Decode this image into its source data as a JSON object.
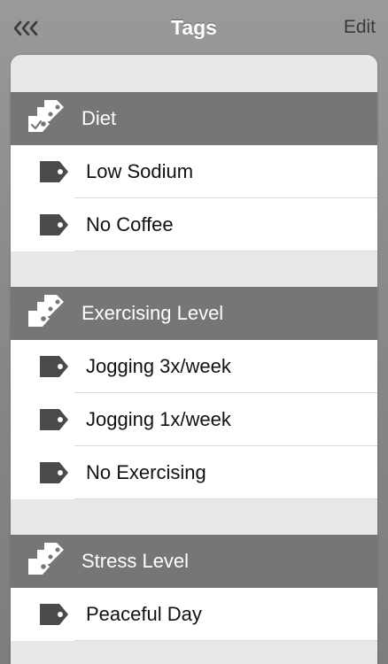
{
  "nav": {
    "back_icon": "triple-chevron-left-icon",
    "title": "Tags",
    "edit_label": "Edit"
  },
  "colors": {
    "section_header_bg": "#767676",
    "row_bg": "#ffffff",
    "icon_fill": "#4a4a4a"
  },
  "sections": [
    {
      "title": "Diet",
      "icon": "tags-stack-icon",
      "items": [
        {
          "label": "Low Sodium",
          "icon": "tag-icon"
        },
        {
          "label": "No Coffee",
          "icon": "tag-icon"
        }
      ]
    },
    {
      "title": "Exercising Level",
      "icon": "tags-stack-icon",
      "items": [
        {
          "label": "Jogging 3x/week",
          "icon": "tag-icon"
        },
        {
          "label": "Jogging 1x/week",
          "icon": "tag-icon"
        },
        {
          "label": "No Exercising",
          "icon": "tag-icon"
        }
      ]
    },
    {
      "title": "Stress Level",
      "icon": "tags-stack-icon",
      "items": [
        {
          "label": "Peaceful Day",
          "icon": "tag-icon"
        }
      ]
    }
  ]
}
